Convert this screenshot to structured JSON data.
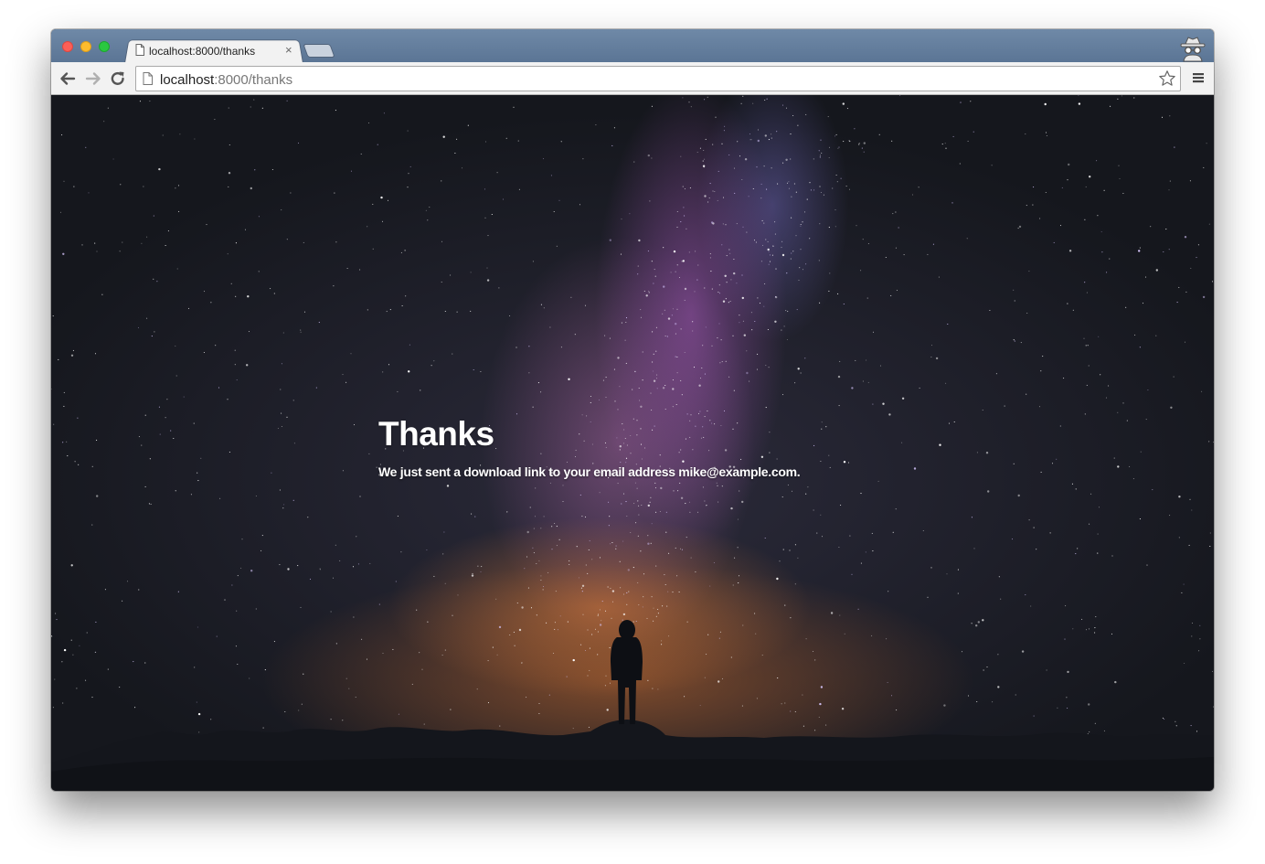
{
  "browser": {
    "tab": {
      "title": "localhost:8000/thanks",
      "close_glyph": "×",
      "icon": "document-icon"
    },
    "address_bar": {
      "host": "localhost",
      "path": ":8000/thanks"
    },
    "icons": {
      "back": "arrow-left-icon",
      "forward": "arrow-right-icon",
      "reload": "reload-icon",
      "bookmark": "star-icon",
      "menu": "hamburger-menu-icon",
      "incognito": "incognito-icon"
    }
  },
  "page": {
    "heading": "Thanks",
    "message": "We just sent a download link to your email address mike@example.com."
  }
}
